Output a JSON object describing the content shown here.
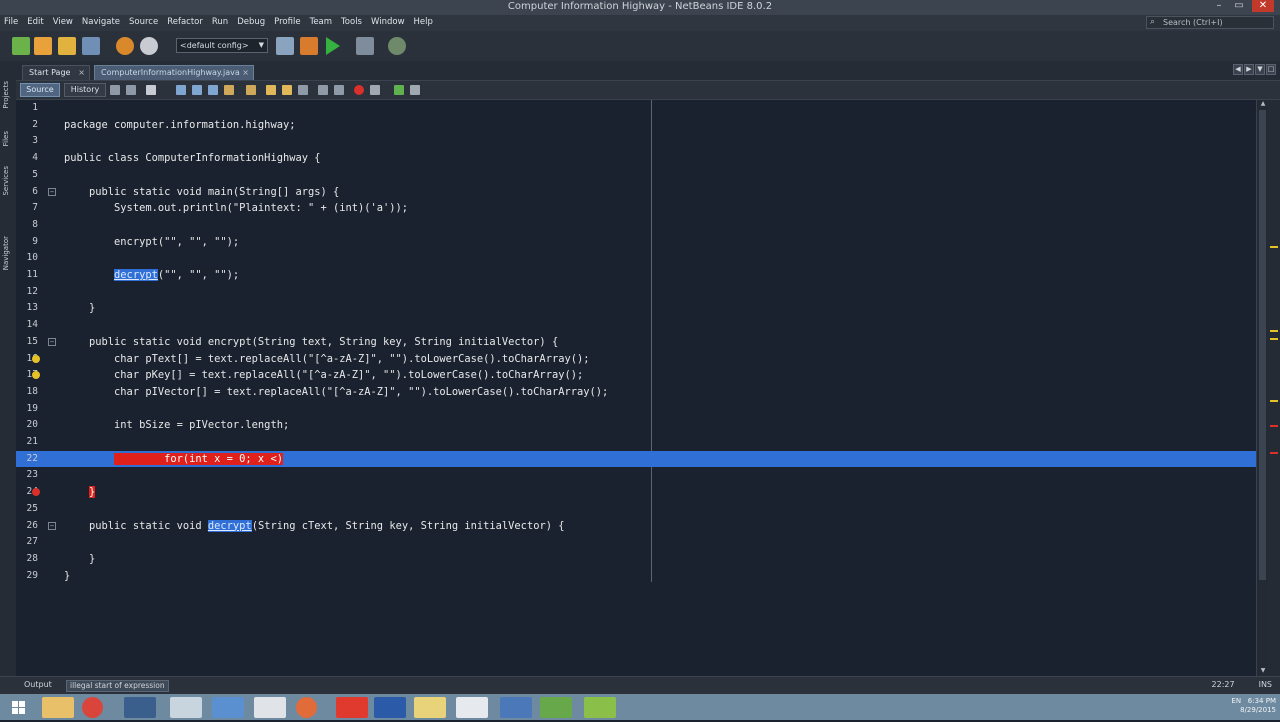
{
  "window": {
    "title": "Computer Information Highway - NetBeans IDE 8.0.2",
    "buttons": [
      "–",
      "▭",
      "✕"
    ]
  },
  "menu": {
    "items": [
      "File",
      "Edit",
      "View",
      "Navigate",
      "Source",
      "Refactor",
      "Run",
      "Debug",
      "Profile",
      "Team",
      "Tools",
      "Window",
      "Help"
    ],
    "search_placeholder": "Search (Ctrl+I)"
  },
  "toolbar": {
    "config_value": "<default config>"
  },
  "side_tabs": [
    "Projects",
    "Files",
    "Services",
    "Navigator"
  ],
  "tabs": {
    "start": "Start Page",
    "active": "ComputerInformationHighway.java",
    "close": "×"
  },
  "editor_toolbar": {
    "source": "Source",
    "history": "History"
  },
  "code": {
    "lines": [
      {
        "n": "1",
        "text": ""
      },
      {
        "n": "2",
        "text": "package computer.information.highway;"
      },
      {
        "n": "3",
        "text": ""
      },
      {
        "n": "4",
        "text": "public class ComputerInformationHighway {"
      },
      {
        "n": "5",
        "text": ""
      },
      {
        "n": "6",
        "text": "    public static void main(String[] args) {"
      },
      {
        "n": "7",
        "text": "        System.out.println(\"Plaintext: \" + (int)('a'));"
      },
      {
        "n": "8",
        "text": ""
      },
      {
        "n": "9",
        "text": "        encrypt(\"\", \"\", \"\");"
      },
      {
        "n": "10",
        "text": ""
      },
      {
        "n": "11",
        "text": "        decrypt(\"\", \"\", \"\");"
      },
      {
        "n": "12",
        "text": ""
      },
      {
        "n": "13",
        "text": "    }"
      },
      {
        "n": "14",
        "text": ""
      },
      {
        "n": "15",
        "text": "    public static void encrypt(String text, String key, String initialVector) {"
      },
      {
        "n": "16",
        "text": "        char pText[] = text.replaceAll(\"[^a-zA-Z]\", \"\").toLowerCase().toCharArray();"
      },
      {
        "n": "17",
        "text": "        char pKey[] = text.replaceAll(\"[^a-zA-Z]\", \"\").toLowerCase().toCharArray();"
      },
      {
        "n": "18",
        "text": "        char pIVector[] = text.replaceAll(\"[^a-zA-Z]\", \"\").toLowerCase().toCharArray();"
      },
      {
        "n": "19",
        "text": ""
      },
      {
        "n": "20",
        "text": "        int bSize = pIVector.length;"
      },
      {
        "n": "21",
        "text": ""
      },
      {
        "n": "22",
        "text": "        for(int x = 0; x <)"
      },
      {
        "n": "23",
        "text": ""
      },
      {
        "n": "24",
        "text": "    }"
      },
      {
        "n": "25",
        "text": ""
      },
      {
        "n": "26",
        "text": "    public static void decrypt(String cText, String key, String initialVector) {"
      },
      {
        "n": "27",
        "text": ""
      },
      {
        "n": "28",
        "text": "    }"
      },
      {
        "n": "29",
        "text": "}"
      }
    ],
    "sel_word": "decrypt"
  },
  "status": {
    "output_label": "Output",
    "error_message": "illegal start of expression",
    "position": "22:27",
    "mode": "INS"
  },
  "taskbar": {
    "time": "6:34 PM",
    "date": "8/29/2015",
    "lang": "EN"
  },
  "colors": {
    "selection": "#2f6fd6",
    "error": "#e0201b",
    "editor_bg": "#1a2230",
    "param": "#d8a85a"
  }
}
